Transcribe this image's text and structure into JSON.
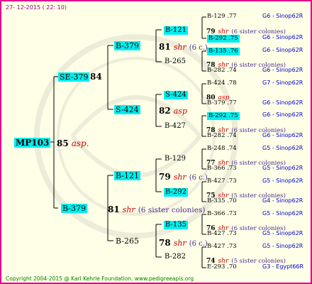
{
  "header": {
    "date": "27- 12-2015 ( 22: 10)"
  },
  "footer": {
    "text": "Copyright 2004-2015 @ Karl Kehrle Foundation.   www.pedigreeapis.org"
  },
  "gen1": {
    "id": "MP103",
    "sire": "85",
    "sire_note": "asp."
  },
  "gen2": [
    {
      "id": "SE-379",
      "sire": "84"
    },
    {
      "id": "B-379",
      "sire": "81",
      "sire_note": "shr",
      "colonies": "(6 sister colonies)"
    }
  ],
  "gen3": [
    {
      "id": "B-379",
      "sire": "81",
      "sire_note": "shr",
      "colonies": "(6 c.)"
    },
    {
      "id": "S-424",
      "sire": "82",
      "sire_note": "asp"
    },
    {
      "id": "B-121",
      "sire": "79",
      "sire_note": "shr",
      "colonies": "(6 c.)"
    },
    {
      "id": "B-265",
      "sire": "78",
      "sire_note": "shr",
      "colonies": "(6 c.)"
    }
  ],
  "gen4": [
    {
      "id": "B-121"
    },
    {
      "id": "B-265"
    },
    {
      "id": "S-424"
    },
    {
      "id": "B-427"
    },
    {
      "id": "B-129"
    },
    {
      "id": "B-292"
    },
    {
      "id": "B-135"
    },
    {
      "id": "B-282"
    }
  ],
  "gen4_sires": [
    {
      "num": "79",
      "note": "shr",
      "colonies": "(6 sister colonies)"
    },
    {
      "num": "78",
      "note": "shr",
      "colonies": "(6 sister colonies)"
    },
    {
      "num": "80",
      "note": "asp"
    },
    {
      "num": "78",
      "note": "shr",
      "colonies": "(6 sister colonies)"
    },
    {
      "num": "77",
      "note": "shr",
      "colonies": "(6 sister colonies)"
    },
    {
      "num": "75",
      "note": "shr",
      "colonies": "(5 sister colonies)"
    },
    {
      "num": "76",
      "note": "shr",
      "colonies": "(6 sister colonies)"
    },
    {
      "num": "74",
      "note": "shr",
      "colonies": "(5 sister colonies)"
    }
  ],
  "gen5": [
    {
      "id": "B-129 .77",
      "src": "G6 - Sinop62R",
      "hl": false
    },
    {
      "id": "B-292 .75",
      "src": "G6 - Sinop62R",
      "hl": true
    },
    {
      "id": "B-135 .76",
      "src": "G6 - Sinop62R",
      "hl": true
    },
    {
      "id": "B-282 .74",
      "src": "G6 - Sinop62R",
      "hl": false
    },
    {
      "id": "B-424 .78",
      "src": "G7 - Sinop62R",
      "hl": false
    },
    {
      "id": "B-379 .77",
      "src": "G6 - Sinop62R",
      "hl": false
    },
    {
      "id": "B-292 .75",
      "src": "G6 - Sinop62R",
      "hl": true
    },
    {
      "id": "B-282 .74",
      "src": "G6 - Sinop62R",
      "hl": false
    },
    {
      "id": "B-248 .74",
      "src": "G5 - Sinop62R",
      "hl": false
    },
    {
      "id": "B-366 .73",
      "src": "G5 - Sinop62R",
      "hl": false
    },
    {
      "id": "B-427 .73",
      "src": "G5 - Sinop62R",
      "hl": false
    },
    {
      "id": "B-335 .70",
      "src": "G4 - Sinop62R",
      "hl": false
    },
    {
      "id": "B-366 .73",
      "src": "G5 - Sinop62R",
      "hl": false
    },
    {
      "id": "B-427 .73",
      "src": "G5 - Sinop62R",
      "hl": false
    },
    {
      "id": "B-427 .73",
      "src": "G5 - Sinop62R",
      "hl": false
    },
    {
      "id": "E-293 .70",
      "src": "G3 - Egypt66R",
      "hl": false
    }
  ]
}
